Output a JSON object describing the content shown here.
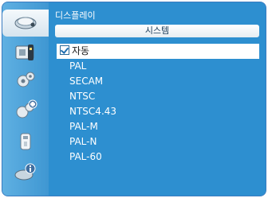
{
  "menu": {
    "title": "디스플레이",
    "submenu_title": "시스템",
    "options": [
      {
        "label": "자동",
        "checked": true
      },
      {
        "label": "PAL",
        "checked": false
      },
      {
        "label": "SECAM",
        "checked": false
      },
      {
        "label": "NTSC",
        "checked": false
      },
      {
        "label": "NTSC4.43",
        "checked": false
      },
      {
        "label": "PAL-M",
        "checked": false
      },
      {
        "label": "PAL-N",
        "checked": false
      },
      {
        "label": "PAL-60",
        "checked": false
      }
    ]
  },
  "sidebar": {
    "items": [
      {
        "icon": "display-icon",
        "selected": true
      },
      {
        "icon": "picture-adjust-icon",
        "selected": false
      },
      {
        "icon": "gear-icon",
        "selected": false
      },
      {
        "icon": "advanced-settings-icon",
        "selected": false
      },
      {
        "icon": "usb-icon",
        "selected": false
      },
      {
        "icon": "info-icon",
        "selected": false
      }
    ]
  },
  "colors": {
    "panel": "#2d8fd0",
    "sidebar": "#4aa3d8",
    "highlight": "#ffffff"
  }
}
